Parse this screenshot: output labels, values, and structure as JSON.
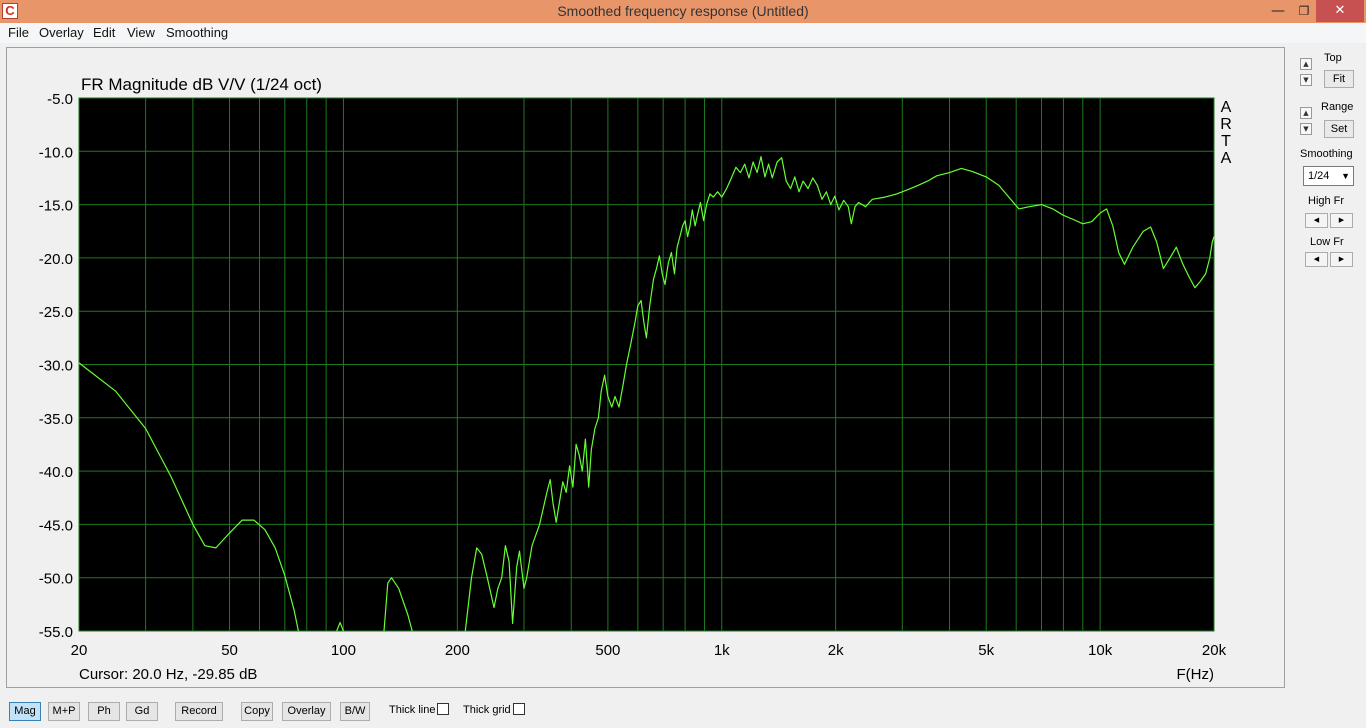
{
  "window": {
    "title": "Smoothed frequency response (Untitled)",
    "icon_letter": "C",
    "controls": {
      "minimize": "—",
      "maximize": "❐",
      "close": "✕"
    }
  },
  "menu": [
    "File",
    "Overlay",
    "Edit",
    "View",
    "Smoothing"
  ],
  "colors": {
    "plot_background": "#000000",
    "grid": "#1e7a1e",
    "trace": "#66ff33",
    "titlebar": "#e8956a"
  },
  "chart_data": {
    "type": "line",
    "title": "FR Magnitude dB V/V (1/24 oct)",
    "xlabel": "F(Hz)",
    "ylabel": "",
    "x_scale": "log",
    "xlim": [
      20,
      20000
    ],
    "ylim": [
      -55,
      -5
    ],
    "x_ticks": [
      20,
      50,
      100,
      200,
      500,
      1000,
      2000,
      5000,
      10000,
      20000
    ],
    "x_tick_labels": [
      "20",
      "50",
      "100",
      "200",
      "500",
      "1k",
      "2k",
      "5k",
      "10k",
      "20k"
    ],
    "y_ticks": [
      -5,
      -10,
      -15,
      -20,
      -25,
      -30,
      -35,
      -40,
      -45,
      -50,
      -55
    ],
    "y_tick_labels": [
      "-5.0",
      "-10.0",
      "-15.0",
      "-20.0",
      "-25.0",
      "-30.0",
      "-35.0",
      "-40.0",
      "-45.0",
      "-50.0",
      "-55.0"
    ],
    "grid": true,
    "watermark": "ARTA",
    "cursor_text": "Cursor: 20.0 Hz, -29.85 dB",
    "series": [
      {
        "points": [
          [
            20,
            -29.85
          ],
          [
            25,
            -32.5
          ],
          [
            30,
            -36.0
          ],
          [
            35,
            -40.5
          ],
          [
            40,
            -45.0
          ],
          [
            43,
            -47.0
          ],
          [
            46,
            -47.2
          ],
          [
            50,
            -45.8
          ],
          [
            54,
            -44.6
          ],
          [
            58,
            -44.6
          ],
          [
            62,
            -45.5
          ],
          [
            66,
            -47.2
          ],
          [
            70,
            -49.8
          ],
          [
            74,
            -53.0
          ],
          [
            76,
            -55.0
          ],
          [
            null,
            null
          ],
          [
            96,
            -55.0
          ],
          [
            98,
            -54.2
          ],
          [
            100,
            -55.0
          ],
          [
            null,
            null
          ],
          [
            128,
            -55.0
          ],
          [
            131,
            -50.5
          ],
          [
            134,
            -50.0
          ],
          [
            140,
            -51.0
          ],
          [
            148,
            -53.5
          ],
          [
            152,
            -55.0
          ],
          [
            null,
            null
          ],
          [
            210,
            -55.0
          ],
          [
            218,
            -50.0
          ],
          [
            225,
            -47.2
          ],
          [
            232,
            -47.8
          ],
          [
            240,
            -50.0
          ],
          [
            250,
            -52.8
          ],
          [
            256,
            -51.0
          ],
          [
            262,
            -50.0
          ],
          [
            268,
            -47.0
          ],
          [
            274,
            -48.5
          ],
          [
            280,
            -54.3
          ],
          [
            287,
            -49.0
          ],
          [
            292,
            -47.5
          ],
          [
            300,
            -51.0
          ],
          [
            305,
            -50.0
          ],
          [
            315,
            -47.0
          ],
          [
            330,
            -45.0
          ],
          [
            345,
            -42.0
          ],
          [
            352,
            -40.8
          ],
          [
            358,
            -43.0
          ],
          [
            365,
            -44.8
          ],
          [
            372,
            -43.0
          ],
          [
            380,
            -41.0
          ],
          [
            388,
            -42.0
          ],
          [
            396,
            -39.5
          ],
          [
            404,
            -41.5
          ],
          [
            412,
            -37.5
          ],
          [
            420,
            -38.5
          ],
          [
            428,
            -40.0
          ],
          [
            436,
            -37.0
          ],
          [
            445,
            -41.5
          ],
          [
            452,
            -38.0
          ],
          [
            462,
            -36.0
          ],
          [
            472,
            -35.0
          ],
          [
            480,
            -32.5
          ],
          [
            490,
            -31.0
          ],
          [
            500,
            -33.0
          ],
          [
            512,
            -34.0
          ],
          [
            522,
            -33.0
          ],
          [
            535,
            -34.0
          ],
          [
            548,
            -32.0
          ],
          [
            560,
            -30.0
          ],
          [
            575,
            -28.0
          ],
          [
            590,
            -26.0
          ],
          [
            600,
            -24.5
          ],
          [
            612,
            -24.0
          ],
          [
            622,
            -26.0
          ],
          [
            632,
            -27.5
          ],
          [
            645,
            -24.5
          ],
          [
            660,
            -22.0
          ],
          [
            672,
            -21.0
          ],
          [
            684,
            -19.8
          ],
          [
            696,
            -21.5
          ],
          [
            708,
            -22.5
          ],
          [
            722,
            -20.5
          ],
          [
            736,
            -19.5
          ],
          [
            750,
            -21.5
          ],
          [
            762,
            -19.0
          ],
          [
            775,
            -18.0
          ],
          [
            788,
            -17.0
          ],
          [
            800,
            -16.5
          ],
          [
            812,
            -18.0
          ],
          [
            824,
            -17.0
          ],
          [
            836,
            -15.5
          ],
          [
            850,
            -17.0
          ],
          [
            862,
            -16.0
          ],
          [
            878,
            -14.8
          ],
          [
            895,
            -16.5
          ],
          [
            912,
            -15.0
          ],
          [
            930,
            -14.0
          ],
          [
            950,
            -14.3
          ],
          [
            975,
            -13.8
          ],
          [
            1000,
            -14.3
          ],
          [
            1030,
            -13.5
          ],
          [
            1060,
            -12.5
          ],
          [
            1090,
            -11.5
          ],
          [
            1120,
            -12.0
          ],
          [
            1150,
            -11.2
          ],
          [
            1180,
            -12.5
          ],
          [
            1210,
            -11.0
          ],
          [
            1240,
            -12.0
          ],
          [
            1270,
            -10.5
          ],
          [
            1300,
            -12.4
          ],
          [
            1330,
            -11.2
          ],
          [
            1360,
            -12.5
          ],
          [
            1400,
            -11.0
          ],
          [
            1440,
            -10.6
          ],
          [
            1480,
            -12.8
          ],
          [
            1520,
            -13.5
          ],
          [
            1560,
            -12.4
          ],
          [
            1600,
            -13.8
          ],
          [
            1640,
            -12.8
          ],
          [
            1690,
            -13.5
          ],
          [
            1740,
            -12.5
          ],
          [
            1790,
            -13.2
          ],
          [
            1840,
            -14.5
          ],
          [
            1890,
            -13.8
          ],
          [
            1940,
            -15.0
          ],
          [
            1990,
            -14.2
          ],
          [
            2040,
            -15.5
          ],
          [
            2100,
            -14.6
          ],
          [
            2160,
            -15.2
          ],
          [
            2200,
            -16.8
          ],
          [
            2250,
            -15.2
          ],
          [
            2300,
            -14.8
          ],
          [
            2400,
            -15.2
          ],
          [
            2500,
            -14.5
          ],
          [
            2700,
            -14.3
          ],
          [
            2900,
            -14.0
          ],
          [
            3100,
            -13.6
          ],
          [
            3300,
            -13.2
          ],
          [
            3500,
            -12.8
          ],
          [
            3700,
            -12.3
          ],
          [
            4000,
            -12.0
          ],
          [
            4300,
            -11.6
          ],
          [
            4600,
            -11.9
          ],
          [
            5000,
            -12.4
          ],
          [
            5400,
            -13.2
          ],
          [
            5800,
            -14.5
          ],
          [
            6100,
            -15.4
          ],
          [
            6500,
            -15.2
          ],
          [
            7000,
            -15.0
          ],
          [
            7500,
            -15.4
          ],
          [
            8000,
            -16.0
          ],
          [
            8500,
            -16.4
          ],
          [
            9000,
            -16.8
          ],
          [
            9500,
            -16.6
          ],
          [
            10000,
            -15.8
          ],
          [
            10400,
            -15.4
          ],
          [
            10800,
            -17.0
          ],
          [
            11200,
            -19.5
          ],
          [
            11600,
            -20.6
          ],
          [
            12200,
            -19.0
          ],
          [
            13000,
            -17.5
          ],
          [
            13600,
            -17.1
          ],
          [
            14100,
            -18.5
          ],
          [
            14700,
            -21.0
          ],
          [
            15300,
            -20.0
          ],
          [
            15900,
            -19.0
          ],
          [
            16500,
            -20.5
          ],
          [
            17200,
            -21.8
          ],
          [
            17800,
            -22.8
          ],
          [
            18400,
            -22.2
          ],
          [
            19000,
            -21.5
          ],
          [
            19500,
            -20.0
          ],
          [
            19800,
            -18.5
          ],
          [
            20000,
            -18.0
          ]
        ]
      }
    ]
  },
  "right_panel": {
    "top_label": "Top",
    "fit_label": "Fit",
    "range_label": "Range",
    "set_label": "Set",
    "smoothing_label": "Smoothing",
    "smoothing_value": "1/24",
    "high_fr_label": "High Fr",
    "low_fr_label": "Low Fr"
  },
  "toolbar": {
    "mag": "Mag",
    "mp": "M+P",
    "ph": "Ph",
    "gd": "Gd",
    "record": "Record",
    "copy": "Copy",
    "overlay": "Overlay",
    "bw": "B/W",
    "thick_line": "Thick line",
    "thick_grid": "Thick grid"
  }
}
